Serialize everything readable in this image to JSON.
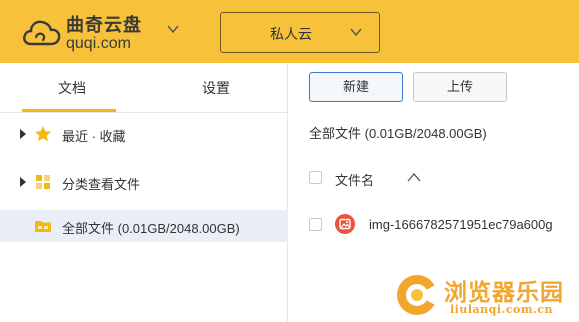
{
  "header": {
    "logo_title": "曲奇云盘",
    "logo_domain": "quqi.com",
    "space_selector": "私人云",
    "colors": {
      "bar": "#f7c23a",
      "accent_underline": "#f3b814"
    }
  },
  "sidebar": {
    "tabs": [
      {
        "label": "文档",
        "active": true
      },
      {
        "label": "设置",
        "active": false
      }
    ],
    "items": [
      {
        "label": "最近 · 收藏",
        "icon": "star-icon"
      },
      {
        "label": "分类查看文件",
        "icon": "category-grid-icon"
      },
      {
        "label": "全部文件 (0.01GB/2048.00GB)",
        "icon": "folder-icon",
        "selected": true
      }
    ]
  },
  "toolbar": {
    "new_label": "新建",
    "upload_label": "上传"
  },
  "main": {
    "breadcrumb": "全部文件 (0.01GB/2048.00GB)",
    "column_name": "文件名",
    "files": [
      {
        "name": "img-1666782571951ec79a600g",
        "icon": "image-file-icon"
      }
    ]
  },
  "watermark": {
    "title": "浏览器乐园",
    "subtitle": "liulanqi.com.cn"
  }
}
